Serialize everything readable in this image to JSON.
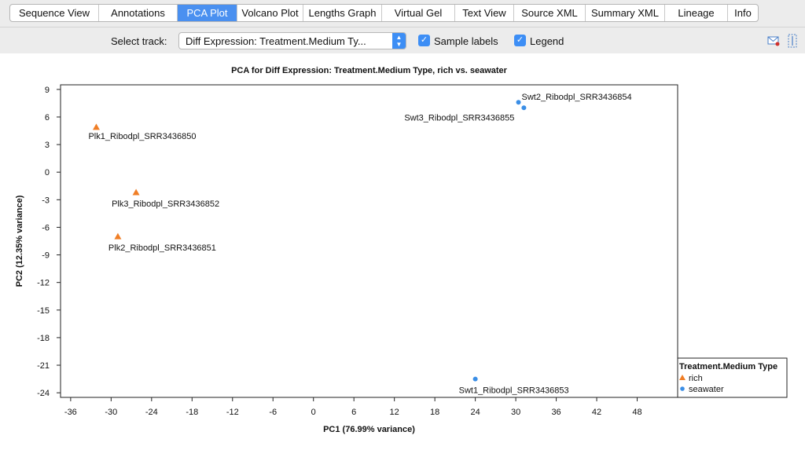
{
  "tabs": [
    {
      "label": "Sequence View",
      "active": false
    },
    {
      "label": "Annotations",
      "active": false
    },
    {
      "label": "PCA Plot",
      "active": true
    },
    {
      "label": "Volcano Plot",
      "active": false
    },
    {
      "label": "Lengths Graph",
      "active": false
    },
    {
      "label": "Virtual Gel",
      "active": false
    },
    {
      "label": "Text View",
      "active": false
    },
    {
      "label": "Source XML",
      "active": false
    },
    {
      "label": "Summary XML",
      "active": false
    },
    {
      "label": "Lineage",
      "active": false
    },
    {
      "label": "Info",
      "active": false
    }
  ],
  "toolbar": {
    "track_label": "Select track:",
    "track_value": "Diff Expression: Treatment.Medium Ty...",
    "sample_labels": {
      "label": "Sample labels",
      "checked": true
    },
    "legend": {
      "label": "Legend",
      "checked": true
    },
    "icons": [
      "mail-icon",
      "dock-icon"
    ]
  },
  "chart_data": {
    "type": "scatter",
    "title": "PCA for Diff Expression: Treatment.Medium Type, rich vs. seawater",
    "xlabel": "PC1 (76.99% variance)",
    "ylabel": "PC2 (12.35% variance)",
    "xlim": [
      -37.5,
      54
    ],
    "ylim": [
      -24.5,
      9.5
    ],
    "xticks": [
      -36,
      -30,
      -24,
      -18,
      -12,
      -6,
      0,
      6,
      12,
      18,
      24,
      30,
      36,
      42,
      48
    ],
    "yticks": [
      9,
      6,
      3,
      0,
      -3,
      -6,
      -9,
      -12,
      -15,
      -18,
      -21,
      -24
    ],
    "grid": false,
    "legend": {
      "title": "Treatment.Medium Type",
      "placement": "bottom-right"
    },
    "series": [
      {
        "name": "rich",
        "marker": "triangle",
        "color": "#f07e26",
        "points": [
          {
            "x": -32.2,
            "y": 4.9,
            "label": "Plk1_Ribodpl_SRR3436850"
          },
          {
            "x": -26.3,
            "y": -2.2,
            "label": "Plk3_Ribodpl_SRR3436852"
          },
          {
            "x": -29.0,
            "y": -7.0,
            "label": "Plk2_Ribodpl_SRR3436851"
          }
        ]
      },
      {
        "name": "seawater",
        "marker": "circle",
        "color": "#3a8ee6",
        "points": [
          {
            "x": 30.4,
            "y": 7.6,
            "label": "Swt2_Ribodpl_SRR3436854"
          },
          {
            "x": 31.2,
            "y": 7.0,
            "label": "Swt3_Ribodpl_SRR3436855"
          },
          {
            "x": 24.0,
            "y": -22.5,
            "label": "Swt1_Ribodpl_SRR3436853"
          }
        ]
      }
    ]
  }
}
